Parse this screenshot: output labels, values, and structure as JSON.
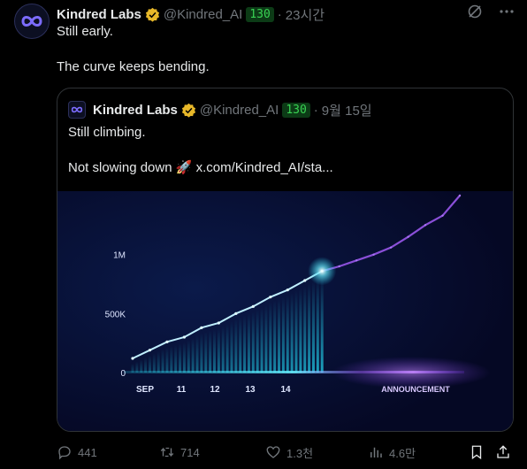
{
  "tweet": {
    "author_name": "Kindred Labs",
    "handle": "@Kindred_AI",
    "badge_count": "130",
    "separator": "·",
    "time": "23시간",
    "lines": [
      "Still early.",
      "The curve keeps bending."
    ]
  },
  "quote": {
    "author_name": "Kindred Labs",
    "handle": "@Kindred_AI",
    "badge_count": "130",
    "separator": "·",
    "time": "9월 15일",
    "line1": "Still climbing.",
    "line2_text": "Not slowing down",
    "emoji": "🚀",
    "link": "x.com/Kindred_AI/sta..."
  },
  "chart_data": {
    "type": "line",
    "x": [
      "SEP",
      "11",
      "12",
      "13",
      "14",
      "ANNOUNCEMENT"
    ],
    "y_ticks": [
      "0",
      "500K",
      "1M"
    ],
    "ylim": [
      0,
      1500000
    ],
    "series": [
      {
        "values": [
          120000,
          190000,
          260000,
          300000,
          380000,
          420000,
          500000,
          560000,
          640000,
          700000,
          780000,
          860000,
          900000,
          950000,
          1000000,
          1060000,
          1150000,
          1250000,
          1330000,
          1500000
        ]
      }
    ],
    "colors": {
      "line_before": "#bfefff",
      "line_after": "#8a4fd8",
      "glow": "#22d3ee",
      "announce_glow": "#b066ff"
    }
  },
  "actions": {
    "replies": "441",
    "reposts": "714",
    "likes": "1.3천",
    "views": "4.6만"
  }
}
